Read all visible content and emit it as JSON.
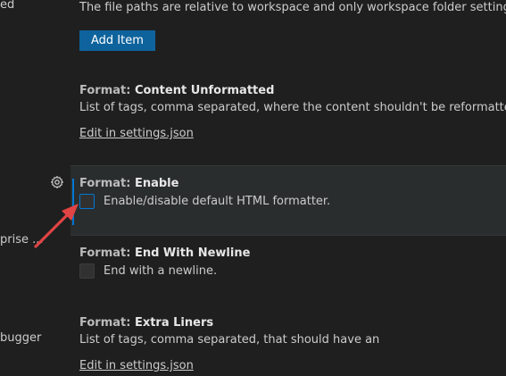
{
  "sidebar": {
    "fragments": [
      "ed",
      "prise ...",
      "bugger"
    ]
  },
  "top_desc": "The file paths are relative to workspace and only workspace folder settings are cons",
  "add_item_label": "Add Item",
  "settings": [
    {
      "category": "Format: ",
      "name": "Content Unformatted",
      "desc_before": "List of tags, comma separated, where the content shouldn't be reformatted. ",
      "desc_code": "null",
      "desc_after": " de",
      "link": "Edit in settings.json"
    },
    {
      "category": "Format: ",
      "name": "Enable",
      "checkbox_label": "Enable/disable default HTML formatter.",
      "checked": false
    },
    {
      "category": "Format: ",
      "name": "End With Newline",
      "checkbox_label": "End with a newline.",
      "checked": false
    },
    {
      "category": "Format: ",
      "name": "Extra Liners",
      "desc": "List of tags, comma separated, that should have an",
      "link": "Edit in settings.json"
    }
  ],
  "icons": {
    "gear": "gear-icon",
    "annotation": "red-arrow-annotation"
  },
  "colors": {
    "background": "#1f1f1f",
    "focused_background": "#2a2d2e",
    "accent": "#0078d4",
    "button": "#0e639c",
    "annotation": "#e04444"
  }
}
